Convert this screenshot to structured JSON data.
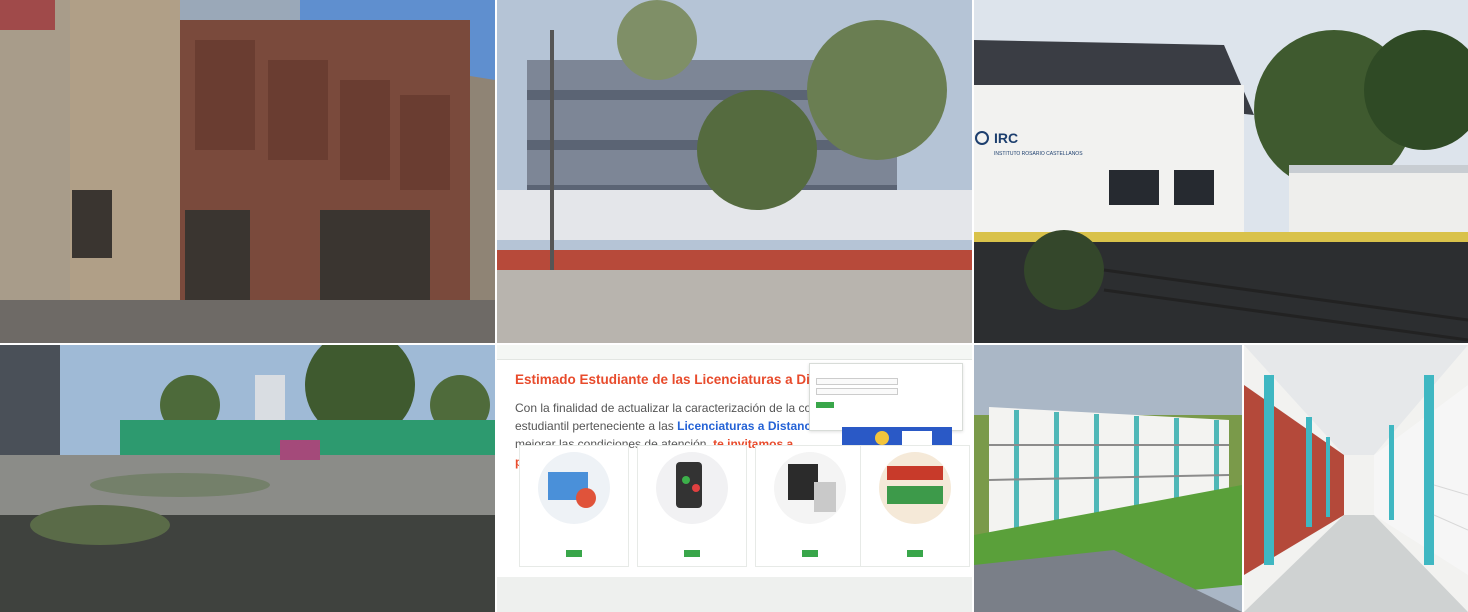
{
  "collage": {
    "tiles": [
      {
        "name": "colonial-building-photo"
      },
      {
        "name": "modern-building-photo"
      },
      {
        "name": "irc-building-photo",
        "sign_main": "IRC",
        "sign_sub": "INSTITUTO ROSARIO CASTELLANOS"
      },
      {
        "name": "courtyard-photo"
      },
      {
        "name": "website-screenshot"
      },
      {
        "name": "building-rendering"
      },
      {
        "name": "corridor-photo"
      }
    ]
  },
  "screenshot": {
    "headline": "Estimado Estudiante de las Licenciaturas a Distan",
    "paragraph_start": "Con la finalidad de actualizar la caracterización de la comunic estudiantil perteneciente a las ",
    "paragraph_highlight": "Licenciaturas a Distanci",
    "paragraph_mid": " mejorar las condiciones de atención, ",
    "paragraph_invite": "te invitamos a participar,",
    "cards": [
      {
        "title": "",
        "subtitle": ""
      },
      {
        "title": "",
        "subtitle": ""
      },
      {
        "title": "",
        "subtitle": ""
      },
      {
        "title": "",
        "subtitle": ""
      }
    ]
  },
  "colors": {
    "accent_red": "#e84b2c",
    "accent_blue": "#2563d6",
    "accent_green": "#39a64a"
  }
}
